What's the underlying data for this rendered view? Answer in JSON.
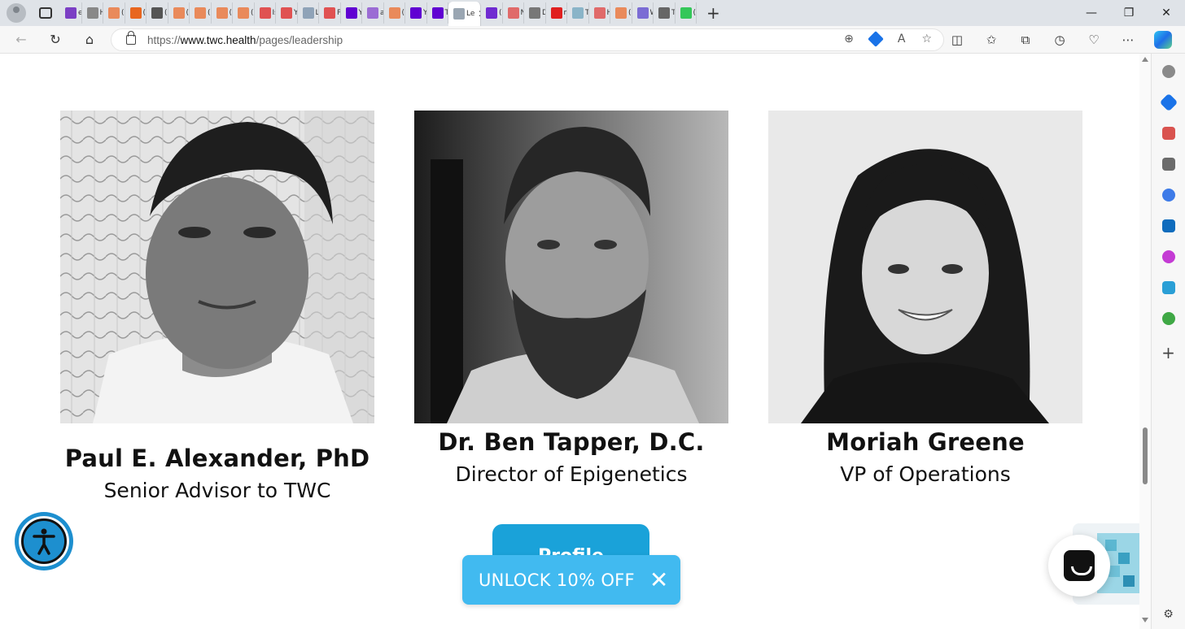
{
  "browser": {
    "tabs": [
      {
        "label": "ed",
        "color": "#7b3fc4"
      },
      {
        "label": "H",
        "color": "#888888"
      },
      {
        "label": "(1",
        "color": "#e98a5b"
      },
      {
        "label": "(1",
        "color": "#e8661f"
      },
      {
        "label": "(1",
        "color": "#555555"
      },
      {
        "label": "(1",
        "color": "#e98a5b"
      },
      {
        "label": "(1",
        "color": "#e98a5b"
      },
      {
        "label": "(1",
        "color": "#e98a5b"
      },
      {
        "label": "(1",
        "color": "#e98a5b"
      },
      {
        "label": "Is",
        "color": "#e05252"
      },
      {
        "label": "Yo",
        "color": "#e05252"
      },
      {
        "label": "Lo",
        "color": "#8fa3b8"
      },
      {
        "label": "Pl",
        "color": "#e05252"
      },
      {
        "label": "Ya",
        "color": "#6001d2"
      },
      {
        "label": "al",
        "color": "#9b6cd4"
      },
      {
        "label": "(1",
        "color": "#e98a5b"
      },
      {
        "label": "Ya",
        "color": "#6001d2"
      },
      {
        "label": "TV",
        "color": "#6001d2"
      },
      {
        "label": "Le",
        "color": "#ffffff",
        "active": true
      },
      {
        "label": "(9",
        "color": "#6f2bd1"
      },
      {
        "label": "N",
        "color": "#e06a6a"
      },
      {
        "label": "D",
        "color": "#777777"
      },
      {
        "label": "m",
        "color": "#e02020"
      },
      {
        "label": "Tl",
        "color": "#8ab4c8"
      },
      {
        "label": "H",
        "color": "#e06a6a"
      },
      {
        "label": "(1",
        "color": "#e98a5b"
      },
      {
        "label": "W",
        "color": "#7b6cd4"
      },
      {
        "label": "Tl",
        "color": "#666666"
      },
      {
        "label": "(4",
        "color": "#34c759"
      }
    ],
    "url_prefix": "https://",
    "url_domain": "www.twc.health",
    "url_path": "/pages/leadership"
  },
  "team": [
    {
      "name": "Paul E. Alexander, PhD",
      "role": "Senior Advisor to TWC"
    },
    {
      "name": "Dr. Ben Tapper, D.C.",
      "role": "Director of Epigenetics"
    },
    {
      "name": "Moriah Greene",
      "role": "VP of Operations"
    }
  ],
  "cta_button": "Profile",
  "promo": {
    "label": "UNLOCK 10% OFF",
    "close": "✕"
  },
  "colors": {
    "accent": "#1aa2d9",
    "promo": "#41baf0",
    "a11y": "#1d8fcf"
  },
  "icons": {
    "accessibility": "accessibility-person-icon",
    "chat": "chat-icon"
  }
}
